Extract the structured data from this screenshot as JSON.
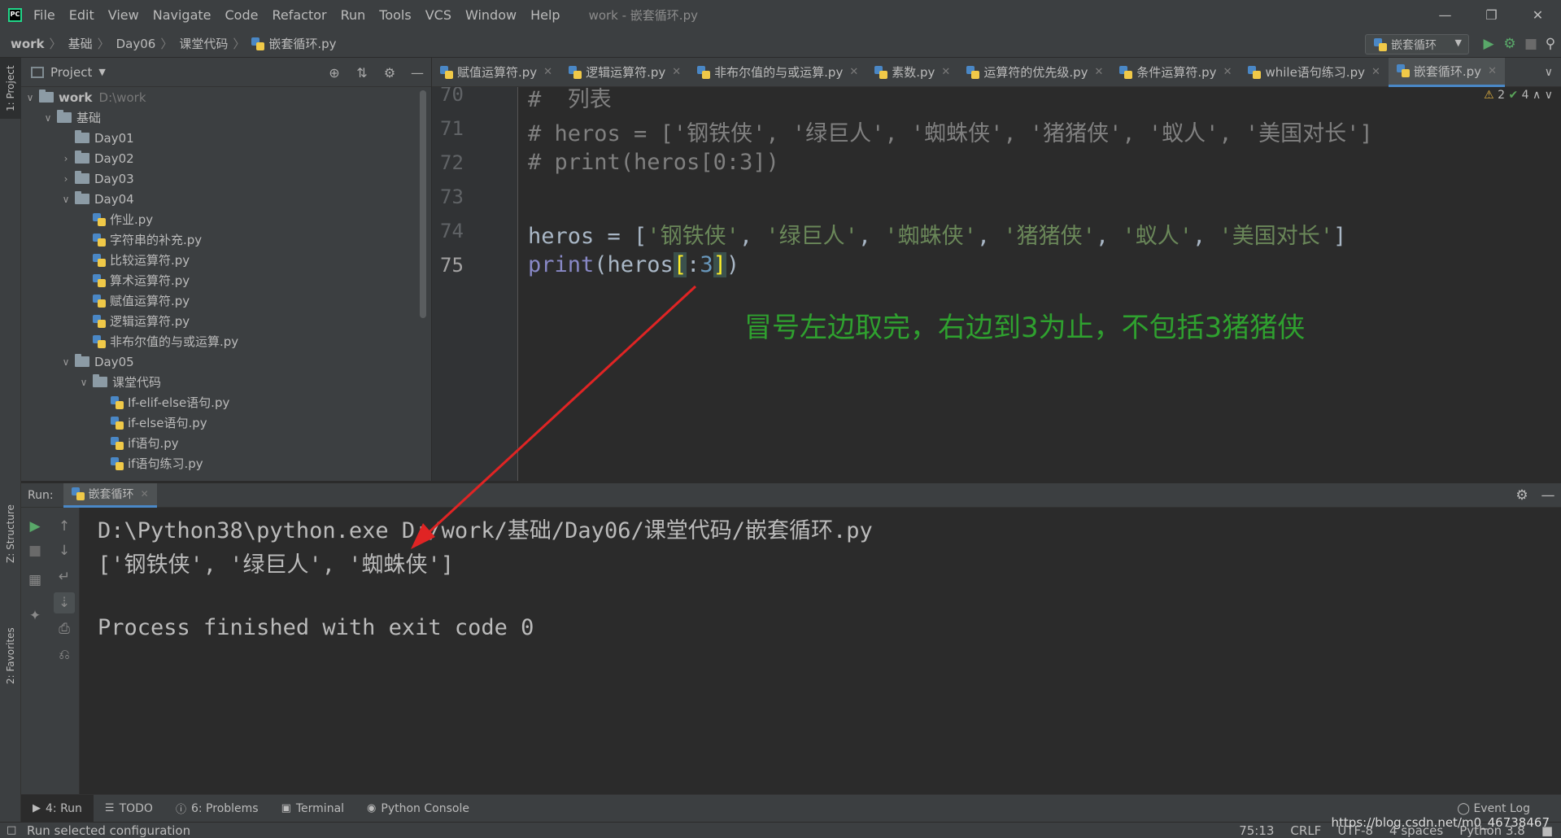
{
  "menubar": {
    "items": [
      "File",
      "Edit",
      "View",
      "Navigate",
      "Code",
      "Refactor",
      "Run",
      "Tools",
      "VCS",
      "Window",
      "Help"
    ],
    "window_title": "work - 嵌套循环.py"
  },
  "breadcrumb": [
    "work",
    "基础",
    "Day06",
    "课堂代码",
    "嵌套循环.py"
  ],
  "run_config": "嵌套循环",
  "project_panel": {
    "title": "Project",
    "root": {
      "name": "work",
      "path": "D:\\work"
    },
    "tree": [
      {
        "label": "基础",
        "type": "folder",
        "depth": 1,
        "state": "open"
      },
      {
        "label": "Day01",
        "type": "folder",
        "depth": 2,
        "state": "none"
      },
      {
        "label": "Day02",
        "type": "folder",
        "depth": 2,
        "state": "closed"
      },
      {
        "label": "Day03",
        "type": "folder",
        "depth": 2,
        "state": "closed"
      },
      {
        "label": "Day04",
        "type": "folder",
        "depth": 2,
        "state": "open"
      },
      {
        "label": "作业.py",
        "type": "file",
        "depth": 3
      },
      {
        "label": "字符串的补充.py",
        "type": "file",
        "depth": 3
      },
      {
        "label": "比较运算符.py",
        "type": "file",
        "depth": 3
      },
      {
        "label": "算术运算符.py",
        "type": "file",
        "depth": 3
      },
      {
        "label": "赋值运算符.py",
        "type": "file",
        "depth": 3
      },
      {
        "label": "逻辑运算符.py",
        "type": "file",
        "depth": 3
      },
      {
        "label": "非布尔值的与或运算.py",
        "type": "file",
        "depth": 3
      },
      {
        "label": "Day05",
        "type": "folder",
        "depth": 2,
        "state": "open"
      },
      {
        "label": "课堂代码",
        "type": "folder",
        "depth": 3,
        "state": "open"
      },
      {
        "label": "If-elif-else语句.py",
        "type": "file",
        "depth": 4
      },
      {
        "label": "if-else语句.py",
        "type": "file",
        "depth": 4
      },
      {
        "label": "if语句.py",
        "type": "file",
        "depth": 4
      },
      {
        "label": "if语句练习.py",
        "type": "file",
        "depth": 4
      }
    ]
  },
  "editor_tabs": [
    {
      "label": "赋值运算符.py",
      "active": false
    },
    {
      "label": "逻辑运算符.py",
      "active": false
    },
    {
      "label": "非布尔值的与或运算.py",
      "active": false
    },
    {
      "label": "素数.py",
      "active": false
    },
    {
      "label": "运算符的优先级.py",
      "active": false
    },
    {
      "label": "条件运算符.py",
      "active": false
    },
    {
      "label": "while语句练习.py",
      "active": false
    },
    {
      "label": "嵌套循环.py",
      "active": true
    }
  ],
  "inspections": {
    "warnings": "2",
    "typos": "4"
  },
  "editor": {
    "line_numbers": [
      "70",
      "71",
      "72",
      "73",
      "74",
      "75"
    ],
    "line70": "#  列表",
    "line71": "# heros = ['钢铁侠', '绿巨人', '蜘蛛侠', '猪猪侠', '蚁人', '美国对长']",
    "line72": "# print(heros[0:3])",
    "line74_var": "heros",
    "line74_eq": " = [",
    "line74_items": [
      "'钢铁侠'",
      "'绿巨人'",
      "'蜘蛛侠'",
      "'猪猪侠'",
      "'蚁人'",
      "'美国对长'"
    ],
    "line74_end": "]",
    "line75_fn": "print",
    "line75_open": "(heros",
    "line75_lb": "[",
    "line75_colon": ":",
    "line75_num": "3",
    "line75_rb": "]",
    "line75_close": ")"
  },
  "annotation": "冒号左边取完，右边到3为止，不包括3猪猪侠",
  "run_panel": {
    "label": "Run:",
    "tab": "嵌套循环"
  },
  "console": {
    "line1": "D:\\Python38\\python.exe D:/work/基础/Day06/课堂代码/嵌套循环.py",
    "line2": "['钢铁侠', '绿巨人', '蜘蛛侠']",
    "line3": "Process finished with exit code 0"
  },
  "bottom_tabs": [
    "4: Run",
    "TODO",
    "6: Problems",
    "Terminal",
    "Python Console"
  ],
  "event_log": "Event Log",
  "left_tool_tabs": [
    "1: Project",
    "Z: Structure",
    "2: Favorites"
  ],
  "status": {
    "message": "Run selected configuration",
    "position": "75:13",
    "line_sep": "CRLF",
    "encoding": "UTF-8",
    "indent": "4 spaces",
    "interpreter": "Python 3.8"
  },
  "watermark": "https://blog.csdn.net/m0_46738467",
  "colors": {
    "accent": "#4a88c7",
    "annotation": "#2fa12f",
    "arrow": "#e02424"
  }
}
